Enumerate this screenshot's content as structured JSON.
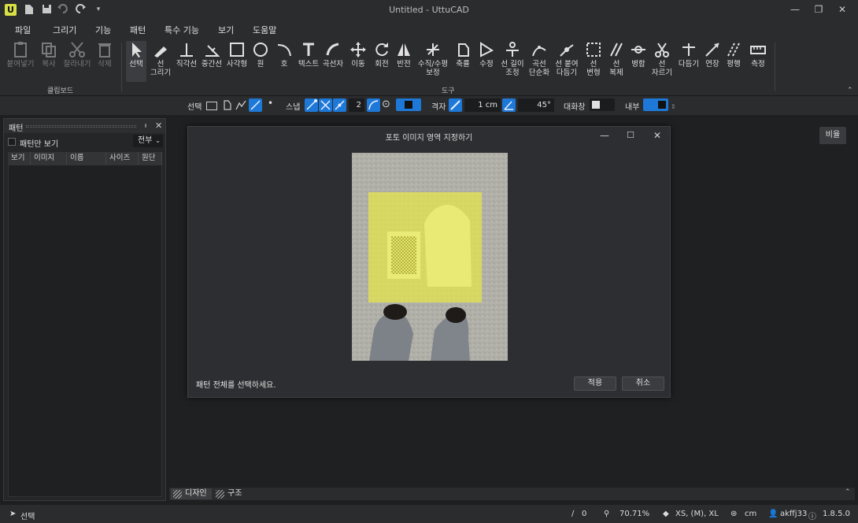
{
  "window": {
    "title": "Untitled - UttuCAD",
    "logo": "U",
    "quick_access_icons": [
      "new-file-icon",
      "save-icon",
      "undo-icon",
      "redo-icon",
      "customize-icon"
    ]
  },
  "menu": [
    "파일",
    "그리기",
    "기능",
    "패턴",
    "특수 기능",
    "보기",
    "도움말"
  ],
  "ribbon": {
    "clipboard": {
      "group_label": "클립보드",
      "tools": [
        "붙여넣기",
        "복사",
        "잘라내기",
        "삭제"
      ]
    },
    "tools_group_label": "도구",
    "tools": [
      {
        "id": "select",
        "l1": "선택",
        "l2": ""
      },
      {
        "id": "line-draw",
        "l1": "선",
        "l2": "그리기"
      },
      {
        "id": "right-angle",
        "l1": "직각선",
        "l2": ""
      },
      {
        "id": "midline",
        "l1": "중간선",
        "l2": ""
      },
      {
        "id": "rectangle",
        "l1": "사각형",
        "l2": ""
      },
      {
        "id": "circle",
        "l1": "원",
        "l2": ""
      },
      {
        "id": "arc",
        "l1": "호",
        "l2": ""
      },
      {
        "id": "text",
        "l1": "텍스트",
        "l2": ""
      },
      {
        "id": "curve-ruler",
        "l1": "곡선자",
        "l2": ""
      },
      {
        "id": "move",
        "l1": "이동",
        "l2": ""
      },
      {
        "id": "rotate",
        "l1": "회전",
        "l2": ""
      },
      {
        "id": "mirror",
        "l1": "반전",
        "l2": ""
      },
      {
        "id": "hv-correct",
        "l1": "수직/수평",
        "l2": "보정"
      },
      {
        "id": "scale",
        "l1": "축률",
        "l2": ""
      },
      {
        "id": "edit",
        "l1": "수정",
        "l2": ""
      },
      {
        "id": "line-length",
        "l1": "선 길이",
        "l2": "조정"
      },
      {
        "id": "curve-simplify",
        "l1": "곡선",
        "l2": "단순화"
      },
      {
        "id": "line-join",
        "l1": "선 붙여",
        "l2": "다듬기"
      },
      {
        "id": "line-transform",
        "l1": "선",
        "l2": "변형"
      },
      {
        "id": "line-copy",
        "l1": "선",
        "l2": "복제"
      },
      {
        "id": "merge",
        "l1": "병합",
        "l2": ""
      },
      {
        "id": "line-cut",
        "l1": "선",
        "l2": "자르기"
      },
      {
        "id": "trim",
        "l1": "다듬기",
        "l2": ""
      },
      {
        "id": "extend",
        "l1": "연장",
        "l2": ""
      },
      {
        "id": "parallel",
        "l1": "평행",
        "l2": ""
      },
      {
        "id": "measure",
        "l1": "측정",
        "l2": ""
      }
    ]
  },
  "options": {
    "select_label": "선택",
    "snap_label": "스냅",
    "snap_value": "2",
    "grid_label": "격자",
    "grid_size": "1 cm",
    "angle": "45°",
    "dialog_label": "대화창",
    "inner_label": "내부"
  },
  "panel": {
    "title": "패턴",
    "pin": "ㅁ",
    "show_pattern_only": "패턴만 보기",
    "filter": "전부",
    "columns": [
      "보기",
      "이미지",
      "이름",
      "사이즈",
      "원단"
    ]
  },
  "ratio_button": "비율",
  "dialog": {
    "title": "포토 이미지 영역 지정하기",
    "message": "패턴 전체를 선택하세요.",
    "apply": "적용",
    "cancel": "취소"
  },
  "tabs": [
    "디자인",
    "구조"
  ],
  "status": {
    "mode": "선택",
    "line_count": "0",
    "zoom": "70.71%",
    "sizes": "XS, (M), XL",
    "unit": "cm",
    "user": "akffj33",
    "version": "1.8.5.0"
  },
  "colors": {
    "accent": "#1e78d8",
    "selection_overlay": "#e6e64a",
    "logo": "#d9e046"
  }
}
